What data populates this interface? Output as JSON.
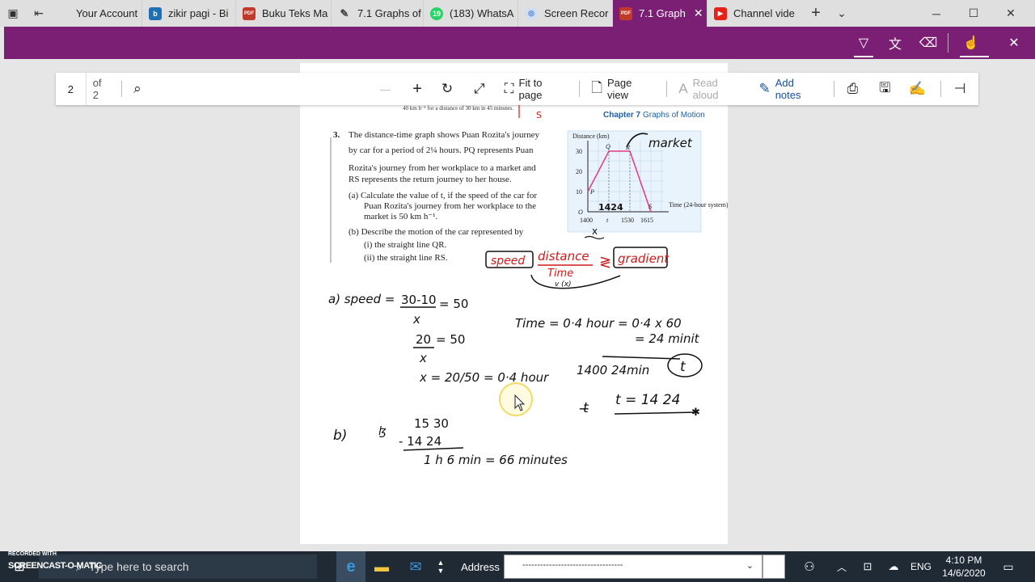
{
  "tabs": [
    {
      "label": "Your Account",
      "color": "#4a7bd0"
    },
    {
      "label": "zikir pagi - Bi",
      "color": "#1f6fb5",
      "glyph": "b"
    },
    {
      "label": "Buku Teks Ma",
      "color": "#c0392b",
      "glyph": "PDF"
    },
    {
      "label": "7.1 Graphs of",
      "color": "#444",
      "glyph": "✎"
    },
    {
      "label": "(183) WhatsA",
      "color": "#25d366",
      "glyph": "19"
    },
    {
      "label": "Screen Recor",
      "color": "#7aa6d8",
      "glyph": "◎"
    },
    {
      "label": "7.1 Graph",
      "color": "#c0392b",
      "glyph": "PDF"
    },
    {
      "label": "Channel vide",
      "color": "#e62117",
      "glyph": "▶"
    }
  ],
  "toolbar": {
    "page": "2",
    "of": "of 2",
    "fit": "Fit to page",
    "pageview": "Page view",
    "read": "Read aloud",
    "notes": "Add notes"
  },
  "doc": {
    "header_small": "40 km h⁻¹ for a distance of 30 km in 45 minutes.",
    "chapter": "Chapter 7",
    "chapter_title": "Graphs of Motion",
    "q_num": "3.",
    "q_text1": "The distance-time graph shows Puan Rozita's journey",
    "q_text2": "by car for a period of 2¼ hours. PQ represents Puan",
    "q_text3": "Rozita's journey from her workplace to a market and",
    "q_text4": "RS represents the return journey to her house.",
    "qa1": "(a) Calculate the value of t, if the speed of the car for",
    "qa2": "Puan Rozita's journey from her workplace to the",
    "qa3": "market is 50 km h⁻¹.",
    "qb": "(b) Describe the motion of the car represented by",
    "qbi": "(i)  the straight line QR.",
    "qbii": "(ii)  the straight line RS.",
    "graph_ylabel": "Distance (km)",
    "graph_xlabel": "Time (24-hour system)",
    "y30": "30",
    "y20": "20",
    "y10": "10",
    "o": "O",
    "x1400": "1400",
    "xt": "t",
    "x1530": "1530",
    "x1615": "1615",
    "pP": "P",
    "pQ": "Q",
    "pR": "R",
    "pS": "S",
    "hw_market": "market",
    "hw_1424": "1424",
    "hw_speed": "speed",
    "hw_distance": "distance",
    "hw_time": "Time",
    "hw_gradient": "gradient",
    "hw_v": "v (x)",
    "hw_a": "a) speed =",
    "hw_f1": "30-10",
    "hw_x1": "x",
    "hw_eq50a": "= 50",
    "hw_f2": "20",
    "hw_x2": "x",
    "hw_eq50b": "= 50",
    "hw_xeq": "x = 20/50 = 0·4 hour",
    "hw_time1": "Time = 0·4 hour = 0·4 x 60",
    "hw_time2": "= 24 minit",
    "hw_1400": "1400   24min",
    "hw_t": "t",
    "hw_teq": "t = 14 24",
    "hw_b": "b)",
    "hw_s1": "15 30",
    "hw_s2": "- 14 24",
    "hw_s3": "1 h   6 min  = 66 minutes"
  },
  "taskbar": {
    "search": "Type here to search",
    "address": "Address",
    "address_value": "----------------------------------",
    "lang": "ENG",
    "time": "4:10 PM",
    "date": "14/6/2020",
    "watermark1": "RECORDED WITH",
    "watermark2": "SCREENCAST-O-MATIC"
  },
  "colors": {
    "accent": "#7b1f74",
    "red": "#d21a1a",
    "graph_line": "#e23b8a"
  }
}
